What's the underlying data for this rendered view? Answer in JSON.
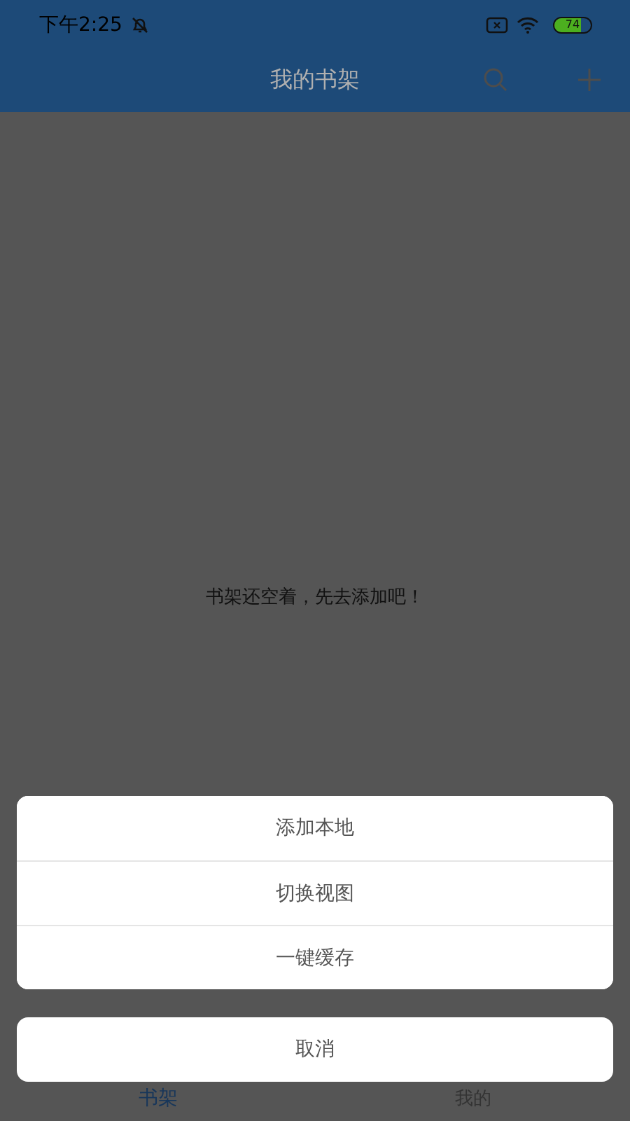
{
  "status_bar": {
    "time": "下午2:25",
    "battery": {
      "text": "74",
      "level": 0.74
    }
  },
  "header": {
    "title": "我的书架"
  },
  "empty_message": "书架还空着，先去添加吧！",
  "tabs": [
    {
      "label": "书架",
      "selected": true
    },
    {
      "label": "我的",
      "selected": false
    }
  ],
  "action_sheet": {
    "items": [
      "添加本地",
      "切换视图",
      "一键缓存"
    ],
    "cancel": "取消"
  }
}
